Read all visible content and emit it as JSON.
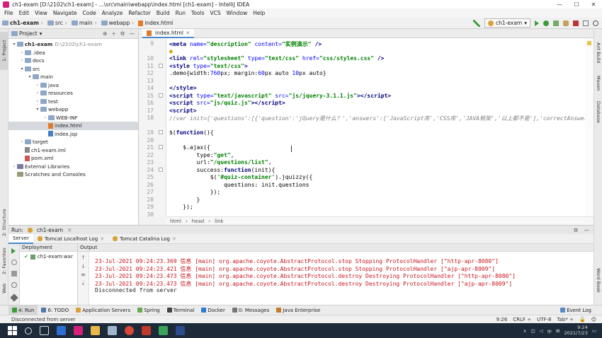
{
  "window": {
    "title": "ch1-exam [D:\\2102\\ch1-exam] - ...\\src\\main\\webapp\\index.html [ch1-exam] - IntelliJ IDEA"
  },
  "menu": [
    "File",
    "Edit",
    "View",
    "Navigate",
    "Code",
    "Analyze",
    "Refactor",
    "Build",
    "Run",
    "Tools",
    "VCS",
    "Window",
    "Help"
  ],
  "breadcrumb": [
    "ch1-exam",
    "src",
    "main",
    "webapp",
    "index.html"
  ],
  "run_config": "ch1-exam",
  "project_panel": {
    "title": "Project",
    "tree": [
      {
        "arrow": "▾",
        "indent": 0,
        "label": "ch1-exam",
        "extra": "D:\\2102\\ch1-exam",
        "type": "folder",
        "bold": true
      },
      {
        "arrow": "›",
        "indent": 1,
        "label": ".idea",
        "type": "folder"
      },
      {
        "arrow": "›",
        "indent": 1,
        "label": "docs",
        "type": "folder"
      },
      {
        "arrow": "▾",
        "indent": 1,
        "label": "src",
        "type": "folder"
      },
      {
        "arrow": "▾",
        "indent": 2,
        "label": "main",
        "type": "folder"
      },
      {
        "arrow": "›",
        "indent": 3,
        "label": "java",
        "type": "folder"
      },
      {
        "arrow": "›",
        "indent": 3,
        "label": "resources",
        "type": "folder"
      },
      {
        "arrow": "›",
        "indent": 3,
        "label": "test",
        "type": "folder"
      },
      {
        "arrow": "▾",
        "indent": 3,
        "label": "webapp",
        "type": "folder"
      },
      {
        "arrow": "›",
        "indent": 4,
        "label": "WEB-INF",
        "type": "folder"
      },
      {
        "arrow": "",
        "indent": 4,
        "label": "index.html",
        "type": "html",
        "selected": true
      },
      {
        "arrow": "",
        "indent": 4,
        "label": "index.jsp",
        "type": "jsp"
      },
      {
        "arrow": "›",
        "indent": 1,
        "label": "target",
        "type": "folder"
      },
      {
        "arrow": "",
        "indent": 1,
        "label": "ch1-exam.iml",
        "type": "iml"
      },
      {
        "arrow": "",
        "indent": 1,
        "label": "pom.xml",
        "type": "xml"
      },
      {
        "arrow": "›",
        "indent": 0,
        "label": "External Libraries",
        "type": "lib"
      },
      {
        "arrow": "",
        "indent": 0,
        "label": "Scratches and Consoles",
        "type": "scratch"
      }
    ]
  },
  "editor": {
    "tab": "index.html",
    "lines": [
      {
        "n": "9",
        "html": "<span class=\"tag\">&lt;meta </span><span class=\"attr\">name=</span><span class=\"str\">\"description\"</span> <span class=\"attr\">content=</span><span class=\"str\">\"实例演示\"</span><span class=\"tag\"> /&gt;</span>"
      },
      {
        "n": "",
        "html": "<span style=\"color:#d4a000\">●</span>"
      },
      {
        "n": "10",
        "html": "<span class=\"tag\">&lt;link </span><span class=\"attr\">rel=</span><span class=\"str\">\"stylesheet\"</span> <span class=\"attr\">type=</span><span class=\"str\">\"text/css\"</span> <span class=\"attr\">href=</span><span class=\"str\">\"css/styles.css\"</span><span class=\"tag\"> /&gt;</span>"
      },
      {
        "n": "11",
        "html": "<span class=\"tag\">&lt;style </span><span class=\"attr\">type=</span><span class=\"str\">\"text/css\"</span><span class=\"tag\">&gt;</span>"
      },
      {
        "n": "12",
        "html": ".demo{width:<span class=\"num\">760</span>px; margin:<span class=\"num\">60</span>px auto <span class=\"num\">10</span>px auto}"
      },
      {
        "n": "13",
        "html": ""
      },
      {
        "n": "14",
        "html": "<span class=\"tag\">&lt;/style&gt;</span>"
      },
      {
        "n": "15",
        "html": "<span class=\"tag\">&lt;script </span><span class=\"attr\">type=</span><span class=\"str\">\"text/javascript\"</span> <span class=\"attr\">src=</span><span class=\"str\">\"js/jquery-3.1.1.js\"</span><span class=\"tag\">&gt;&lt;/script&gt;</span>"
      },
      {
        "n": "16",
        "html": "<span class=\"tag\">&lt;script </span><span class=\"attr\">src=</span><span class=\"str\">\"js/quiz.js\"</span><span class=\"tag\">&gt;&lt;/script&gt;</span>"
      },
      {
        "n": "17",
        "html": "<span class=\"tag\">&lt;script&gt;</span>"
      },
      {
        "n": "18",
        "html": "<span class=\"cmt\">//var init={'questions':[{'question':'jQuery是什么？','answers':['JavaScript库','CSS库','JAVA框架','以上都不是'],'correctAnswer</span>"
      },
      {
        "n": "",
        "html": ""
      },
      {
        "n": "19",
        "html": "$(<span class=\"kw\">function</span>(){"
      },
      {
        "n": "20",
        "html": ""
      },
      {
        "n": "21",
        "html": "    $.ajax({"
      },
      {
        "n": "22",
        "html": "        type:<span class=\"str\">\"get\"</span>,"
      },
      {
        "n": "23",
        "html": "        url:<span class=\"str\">\"/questions/list\"</span>,"
      },
      {
        "n": "24",
        "html": "        success:<span class=\"kw\">function</span>(init){"
      },
      {
        "n": "25",
        "html": "            $(<span class=\"str\">'#quiz-container'</span>).jquizzy({"
      },
      {
        "n": "26",
        "html": "                questions: init.questions"
      },
      {
        "n": "27",
        "html": "            });"
      },
      {
        "n": "28",
        "html": "        }"
      },
      {
        "n": "29",
        "html": "    });"
      },
      {
        "n": "30",
        "html": ""
      }
    ],
    "crumbs": [
      "html",
      "head",
      "link"
    ]
  },
  "run_panel": {
    "label": "Run:",
    "config": "ch1-exam",
    "tabs": [
      "Server",
      "Tomcat Localhost Log",
      "Tomcat Catalina Log"
    ],
    "deployment_header": "Deployment",
    "output_header": "Output",
    "deployment_item": "ch1-exam:war",
    "output_lines": [
      {
        "text": "23-Jul-2021 09:24:23.369 信息 [main] org.apache.coyote.AbstractProtocol.stop Stopping ProtocolHandler [\"http-apr-8080\"]",
        "color": "#c8161d"
      },
      {
        "text": "23-Jul-2021 09:24:23.421 信息 [main] org.apache.coyote.AbstractProtocol.stop Stopping ProtocolHandler [\"ajp-apr-8009\"]",
        "color": "#c8161d"
      },
      {
        "text": "23-Jul-2021 09:24:23.473 信息 [main] org.apache.coyote.AbstractProtocol.destroy Destroying ProtocolHandler [\"http-apr-8080\"]",
        "color": "#c8161d"
      },
      {
        "text": "23-Jul-2021 09:24:23.473 信息 [main] org.apache.coyote.AbstractProtocol.destroy Destroying ProtocolHandler [\"ajp-apr-8009\"]",
        "color": "#c8161d"
      },
      {
        "text": "Disconnected from server",
        "color": "#222222"
      }
    ]
  },
  "bottom_tabs": [
    "4: Run",
    "6: TODO",
    "Application Servers",
    "Spring",
    "Terminal",
    "Docker",
    "0: Messages",
    "Java Enterprise"
  ],
  "event_log": "Event Log",
  "left_strip": [
    "1: Project",
    "2: Structure",
    "2: Favorites",
    "Web"
  ],
  "right_strip": [
    "Ant Build",
    "Maven",
    "Database",
    "Word Book"
  ],
  "status": {
    "message": "Disconnected from server",
    "position": "9:26",
    "line_sep": "CRLF ÷",
    "encoding": "UTF-8",
    "indent": "Tab* ÷"
  },
  "taskbar": {
    "time": "9:24",
    "date": "2021/7/23",
    "ime": "中"
  },
  "colors": {
    "accent": "#4a88c7",
    "error_text": "#c8161d",
    "taskbar": "#1c2a3a"
  }
}
